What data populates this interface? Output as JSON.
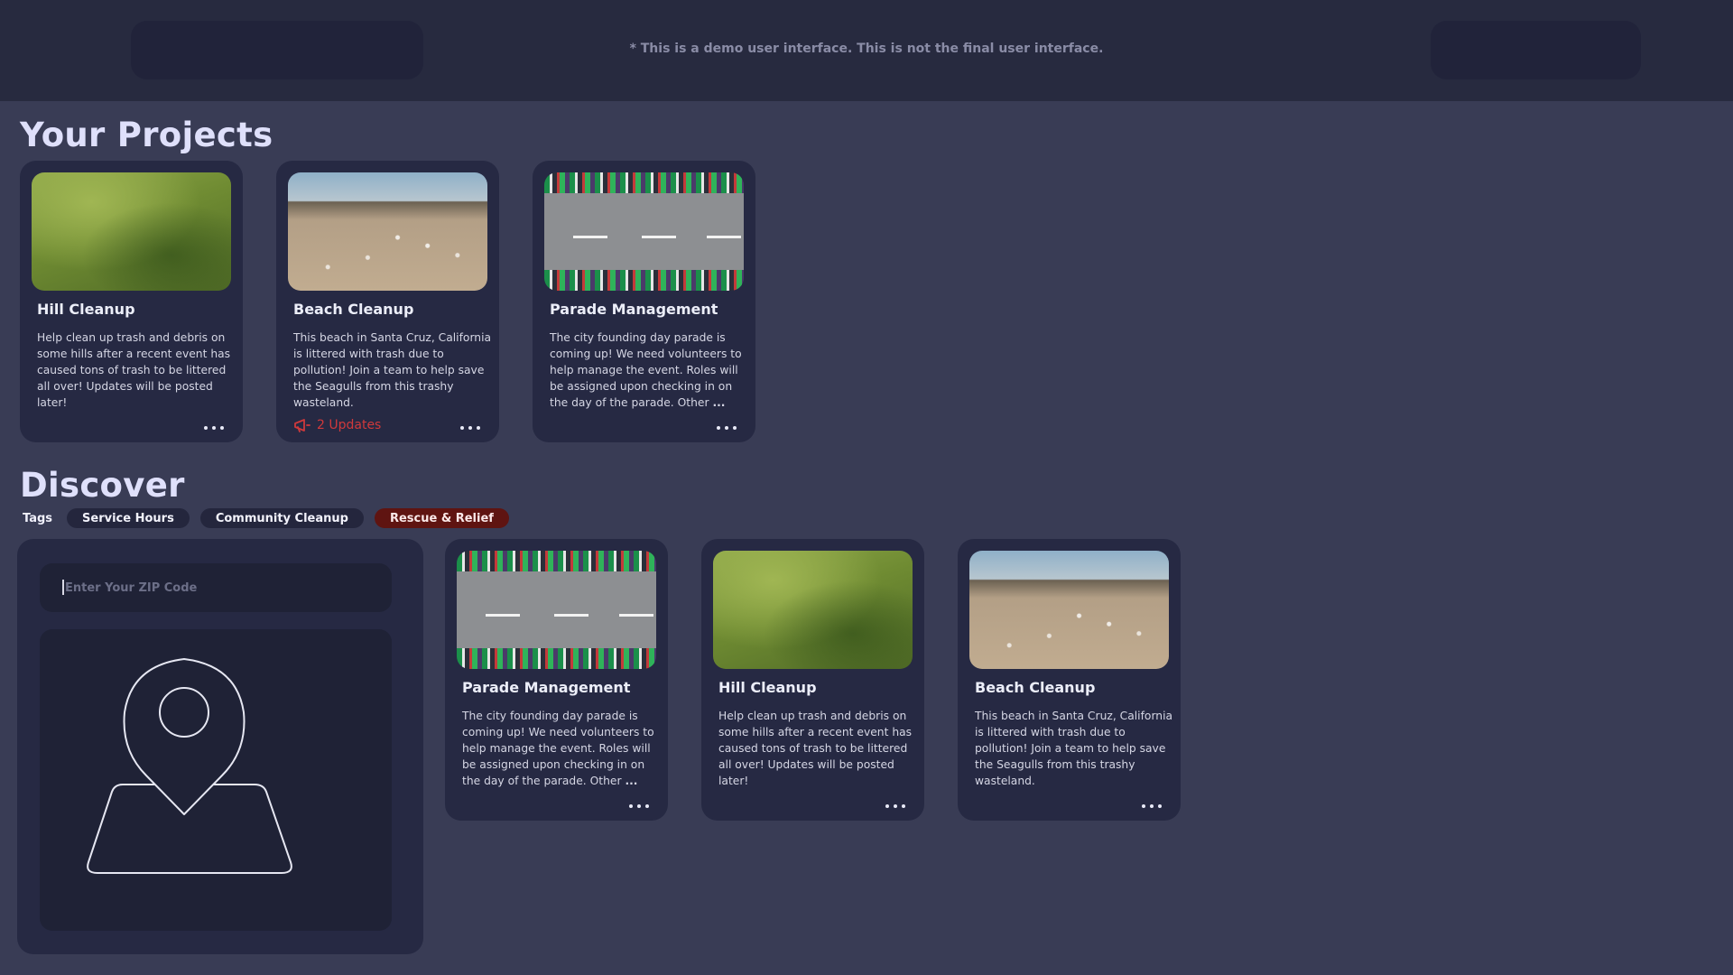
{
  "header": {
    "demo_note": "* This is a demo user interface. This is not the final user interface."
  },
  "projects": {
    "title": "Your Projects",
    "cards": [
      {
        "title": "Hill Cleanup",
        "description": "Help clean up trash and debris on some hills after a recent event has caused tons of trash to be littered all over! Updates will be posted later!",
        "image": "green-hills-photo"
      },
      {
        "title": "Beach Cleanup",
        "description": "This beach in Santa Cruz, California is littered with trash due to pollution! Join a team to help save the Seagulls from this trashy wasteland.",
        "image": "littered-beach-photo",
        "updates": "2 Updates"
      },
      {
        "title": "Parade Management",
        "description": "The city founding day parade is coming up! We need volunteers to help manage the event. Roles will be assigned upon checking in on the day of the parade. Other",
        "ellipsis": "...",
        "image": "parade-crowd-photo"
      }
    ]
  },
  "discover": {
    "title": "Discover",
    "tags_label": "Tags",
    "tags": [
      "Service Hours",
      "Community Cleanup",
      "Rescue & Relief"
    ],
    "active_tag": "Rescue & Relief",
    "zip_placeholder": "Enter Your ZIP Code",
    "cards": [
      {
        "title": "Parade Management",
        "description": "The city founding day parade is coming up! We need volunteers to help manage the event. Roles will be assigned upon checking in on the day of the parade. Other",
        "ellipsis": "...",
        "image": "parade-crowd-photo"
      },
      {
        "title": "Hill Cleanup",
        "description": "Help clean up trash and debris on some hills after a recent event has caused tons of trash to be littered all over! Updates will be posted later!",
        "image": "green-hills-photo"
      },
      {
        "title": "Beach Cleanup",
        "description": "This beach in Santa Cruz, California is littered with trash due to pollution! Join a team to help save the Seagulls from this trashy wasteland.",
        "image": "littered-beach-photo"
      }
    ]
  },
  "icons": {
    "more": "more-dots-icon",
    "megaphone": "megaphone-icon",
    "map_pin": "map-pin-icon"
  },
  "colors": {
    "background": "#393c55",
    "header": "#272a3f",
    "card": "#262943",
    "accent_red": "#d0393b",
    "active_tag": "#5f1411"
  }
}
